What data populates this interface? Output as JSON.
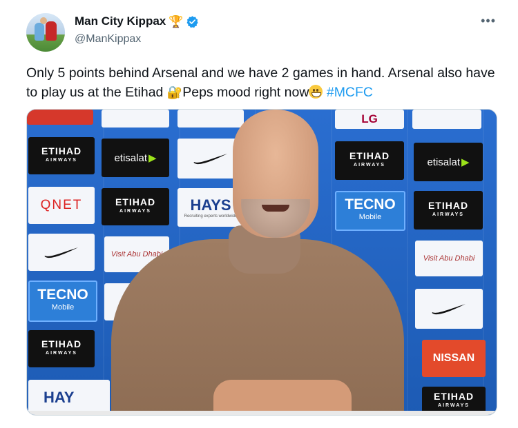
{
  "author": {
    "display_name": "Man City Kippax",
    "name_emoji": "🏆",
    "handle": "@ManKippax",
    "verified_icon": "verified-badge-icon",
    "verified_color": "#1d9bf0"
  },
  "menu": {
    "more_label": "•••"
  },
  "tweet": {
    "text_part1": "Only 5 points behind Arsenal and we have 2 games in hand. Arsenal also have to play us at the Etihad ",
    "key_emoji": "🔐",
    "text_part2": "Peps mood right now",
    "hashtag": "#MCFC",
    "hashtag_color": "#1d9bf0"
  },
  "media": {
    "sponsor_boards": {
      "etihad": "ETIHAD",
      "etihad_sub": "AIRWAYS",
      "etisalat": "etisalat",
      "qnet": "QNET",
      "hays": "HAYS",
      "hays_sub": "Recruiting experts worldwide",
      "tecno": "TECNO",
      "tecno_sub": "Mobile",
      "lg": "LG",
      "nissan": "NISSAN",
      "visit": "Visit Abu Dhabi",
      "hay_partial": "HAY"
    }
  }
}
